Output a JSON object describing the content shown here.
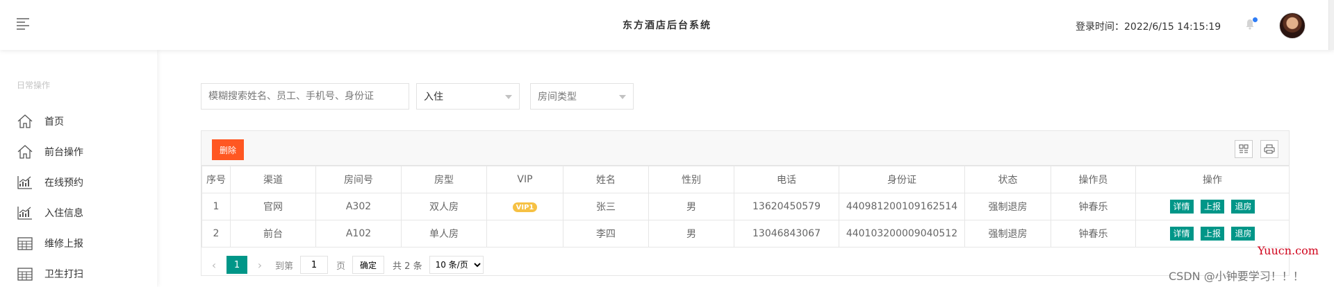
{
  "header": {
    "title": "东方酒店后台系统",
    "login_time": "登录时间：2022/6/15 14:15:19",
    "colors": {
      "notification_dot": "#2f7df6"
    }
  },
  "sidebar": {
    "section_label": "日常操作",
    "items": [
      {
        "label": "首页",
        "icon": "home-icon"
      },
      {
        "label": "前台操作",
        "icon": "home-icon"
      },
      {
        "label": "在线预约",
        "icon": "chart-icon"
      },
      {
        "label": "入住信息",
        "icon": "chart-icon"
      },
      {
        "label": "维修上报",
        "icon": "calendar-icon"
      },
      {
        "label": "卫生打扫",
        "icon": "calendar-icon"
      }
    ]
  },
  "filters": {
    "search_placeholder": "模糊搜索姓名、员工、手机号、身份证",
    "status_select": "入住",
    "room_type_placeholder": "房间类型"
  },
  "toolbar": {
    "delete_label": "删除",
    "colors": {
      "delete": "#ff5722",
      "primary": "#009688"
    }
  },
  "table": {
    "columns": [
      "序号",
      "渠道",
      "房间号",
      "房型",
      "VIP",
      "姓名",
      "性别",
      "电话",
      "身份证",
      "状态",
      "操作员",
      "操作"
    ],
    "rows": [
      {
        "index": "1",
        "channel": "官网",
        "room": "A302",
        "room_type": "双人房",
        "vip": "VIP1",
        "name": "张三",
        "gender": "男",
        "phone": "13620450579",
        "id_card": "440981200109162514",
        "status": "强制退房",
        "operator": "钟春乐"
      },
      {
        "index": "2",
        "channel": "前台",
        "room": "A102",
        "room_type": "单人房",
        "vip": "",
        "name": "李四",
        "gender": "男",
        "phone": "13046843067",
        "id_card": "440103200009040512",
        "status": "强制退房",
        "operator": "钟春乐"
      }
    ],
    "actions": {
      "detail": "详情",
      "report": "上报",
      "checkout": "退房"
    }
  },
  "pager": {
    "current": "1",
    "goto_label": "到第",
    "goto_value": "1",
    "page_unit": "页",
    "confirm": "确定",
    "total": "共 2 条",
    "page_size": "10 条/页"
  },
  "watermarks": {
    "site": "Yuucn.com",
    "author": "CSDN @小钟要学习！！！"
  }
}
